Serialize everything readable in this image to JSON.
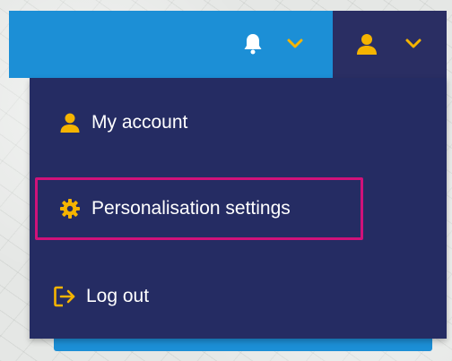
{
  "colors": {
    "header_blue": "#1c8fd6",
    "navy": "#252c63",
    "icon_yellow": "#f5b400",
    "highlight": "#d0127a"
  },
  "header": {
    "icons": [
      "bell-icon",
      "chevron-down-icon",
      "user-icon",
      "chevron-down-icon"
    ]
  },
  "menu": {
    "items": [
      {
        "label": "My account",
        "icon": "user-icon"
      },
      {
        "label": "Personalisation settings",
        "icon": "gear-icon",
        "highlighted": true
      },
      {
        "label": "Log out",
        "icon": "logout-icon"
      }
    ]
  }
}
